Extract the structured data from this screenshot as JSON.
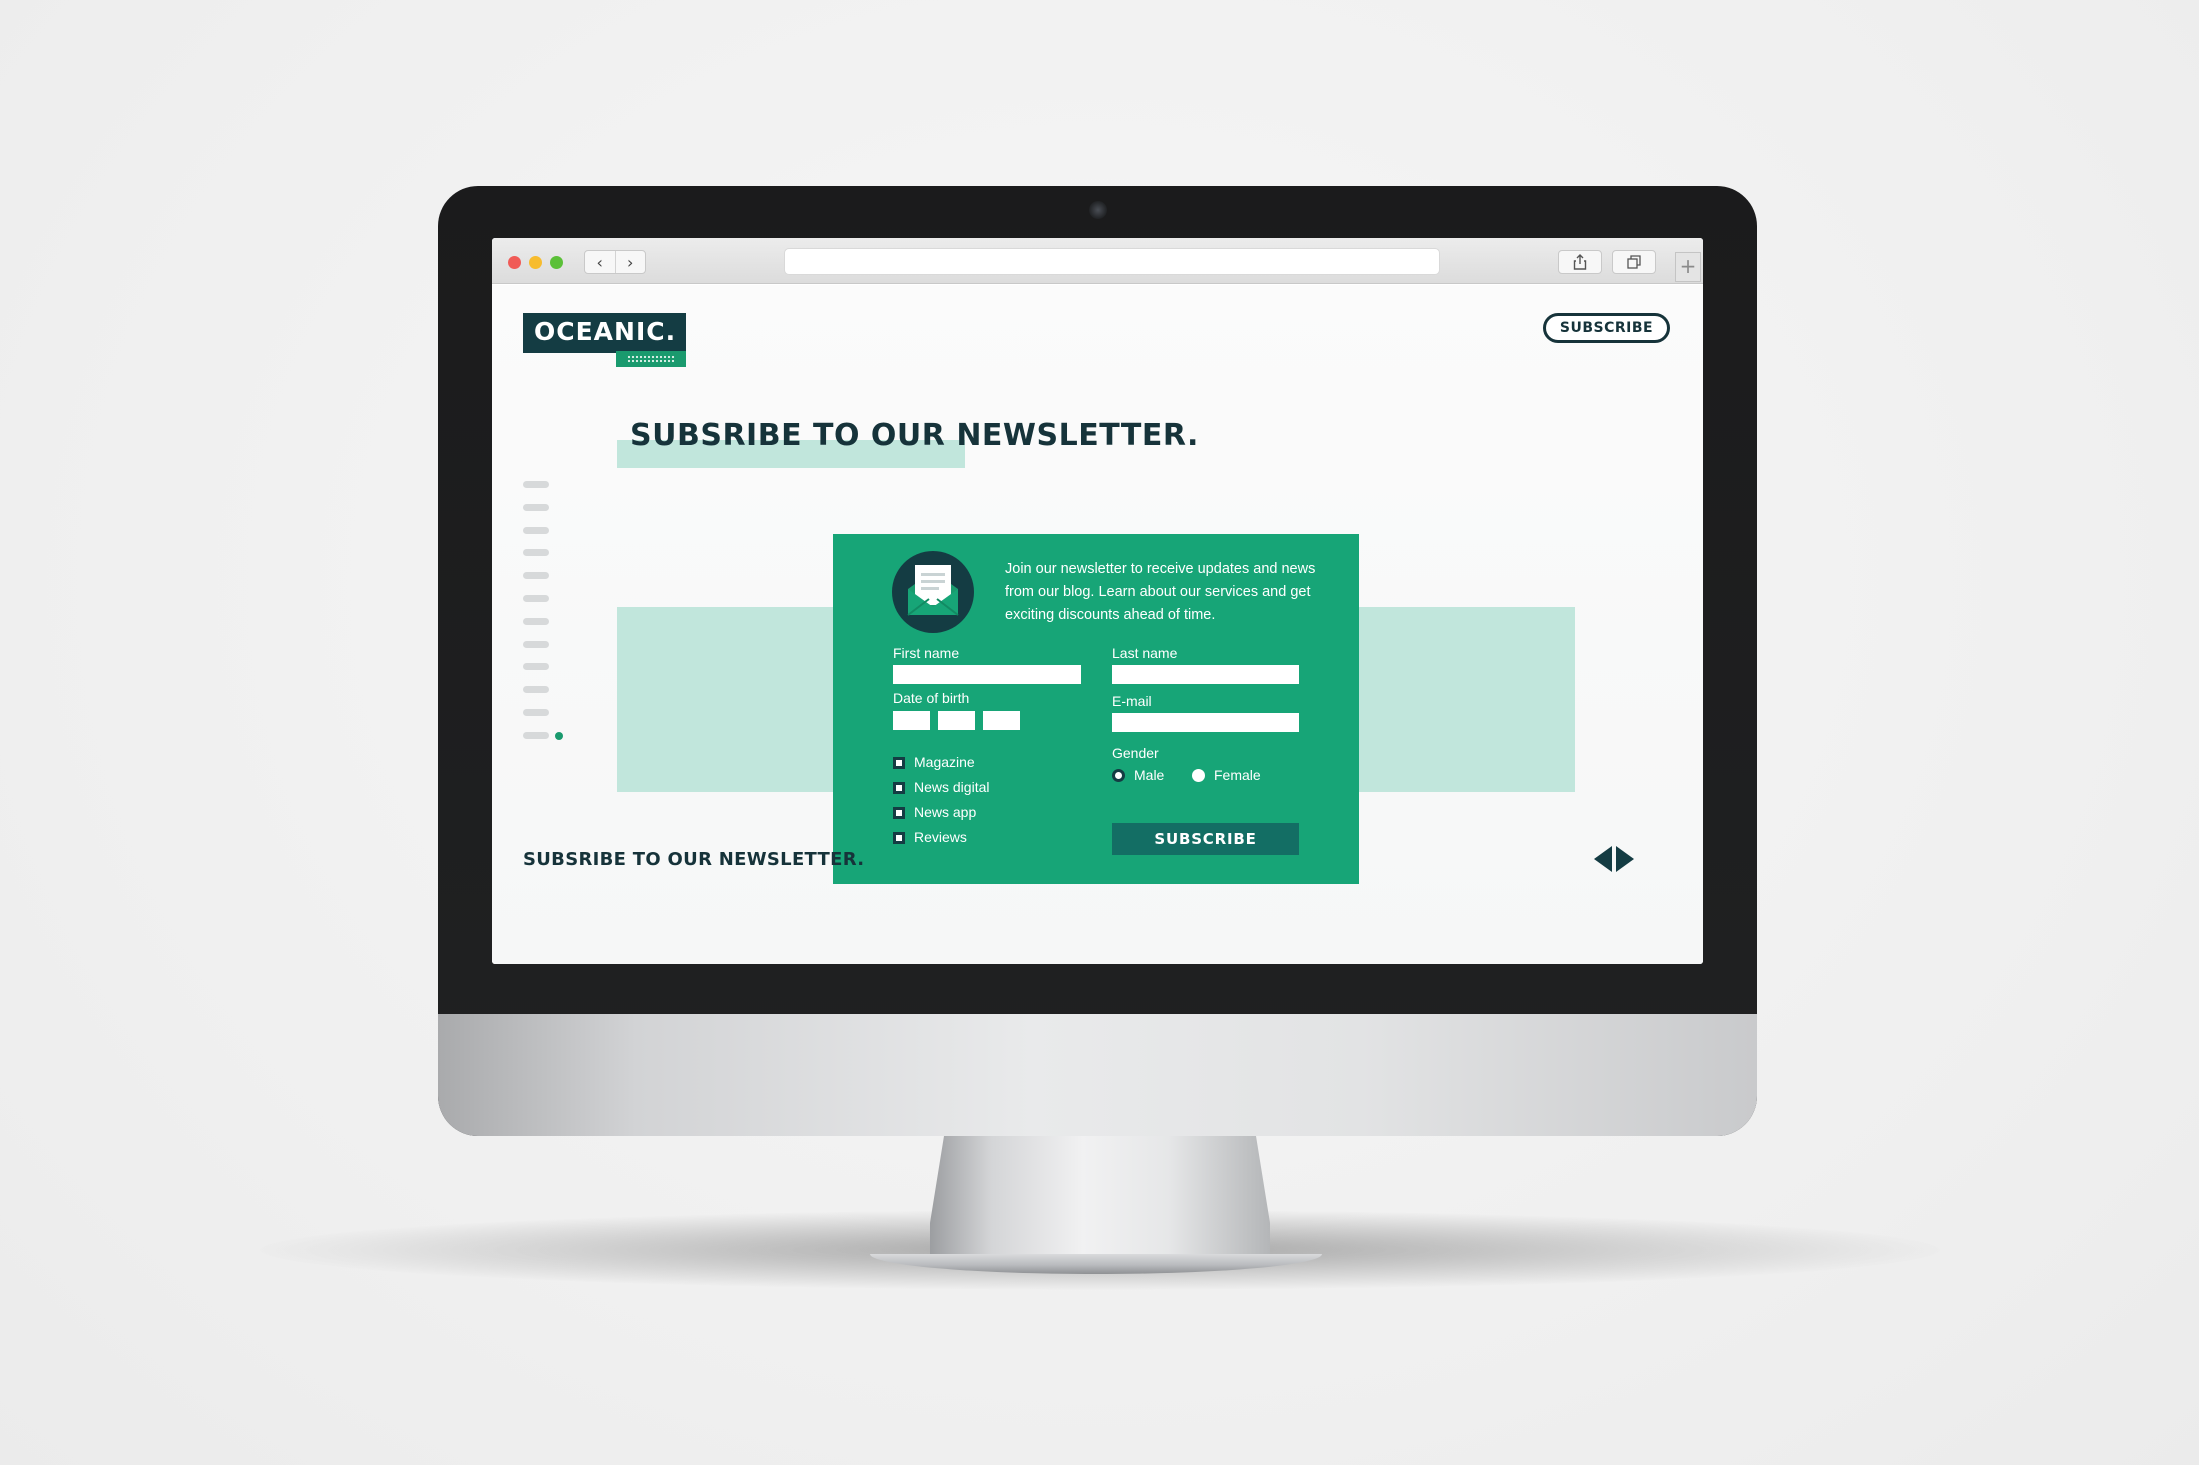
{
  "browser": {
    "url": ""
  },
  "site": {
    "logo_text": "OCEANIC.",
    "header_button": "SUBSCRIBE",
    "page_title": "SUBSRIBE TO OUR NEWSLETTER.",
    "footer_title": "SUBSRIBE TO OUR NEWSLETTER.",
    "side_nav": {
      "dash_count": 12,
      "active_index": 11
    }
  },
  "form": {
    "intro": "Join our newsletter to receive updates and news from our blog. Learn about our services and get exciting discounts ahead of time.",
    "first_name_label": "First name",
    "first_name_value": "",
    "last_name_label": "Last name",
    "last_name_value": "",
    "dob_label": "Date of birth",
    "email_label": "E-mail",
    "email_value": "",
    "gender_label": "Gender",
    "gender_options": [
      "Male",
      "Female"
    ],
    "gender_selected": "Male",
    "interests": [
      "Magazine",
      "News digital",
      "News app",
      "Reviews"
    ],
    "submit_label": "SUBSCRIBE"
  },
  "colors": {
    "brand_dark": "#143c43",
    "brand_green": "#17a577",
    "band_mint": "#c1e6dc",
    "button_teal": "#136e64"
  }
}
